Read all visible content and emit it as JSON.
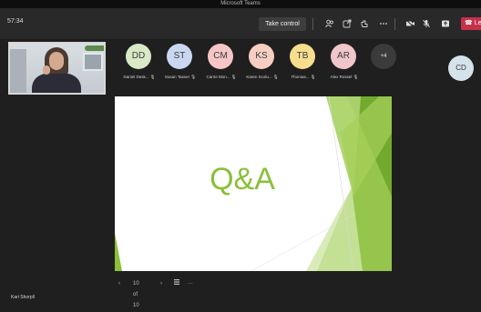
{
  "window": {
    "title": "Microsoft Teams"
  },
  "toolbar": {
    "timer": "57:34",
    "take_control_label": "Take control",
    "leave_label": "Le",
    "icons": [
      "participants-icon",
      "share-icon",
      "reactions-icon",
      "more-icon",
      "camera-off-icon",
      "mic-off-icon",
      "share-tray-icon"
    ]
  },
  "participants": [
    {
      "initials": "DD",
      "name": "Daniel Desk...",
      "color": "#d7e9c5"
    },
    {
      "initials": "ST",
      "name": "Susan Tasser",
      "color": "#c9d7f1"
    },
    {
      "initials": "CM",
      "name": "Carrie Mon...",
      "color": "#f6c6c6"
    },
    {
      "initials": "KS",
      "name": "Karen Scolu...",
      "color": "#f6cfc2"
    },
    {
      "initials": "TB",
      "name": "Thomas...",
      "color": "#f7de8e"
    },
    {
      "initials": "AR",
      "name": "Alex Rossel",
      "color": "#f1c6cb"
    }
  ],
  "more_count": "+4",
  "side_avatar": {
    "initials": "CD"
  },
  "slide": {
    "title": "Q&A"
  },
  "slide_nav": {
    "page": "10 of 10"
  },
  "presenter": {
    "name": "Kari Shorpll"
  },
  "colors": {
    "accent_green": "#8bbf3a",
    "leave_red": "#c4314b"
  }
}
